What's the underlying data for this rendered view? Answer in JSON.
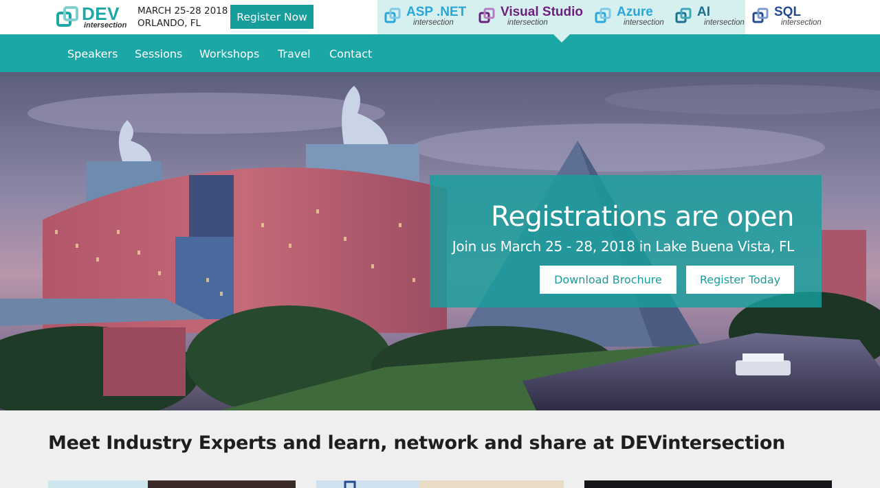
{
  "header": {
    "logo": {
      "title": "DEV",
      "subtitle": "intersection",
      "color": "#1ba7a5"
    },
    "event_date_line1": "MARCH 25-28 2018",
    "event_date_line2": "ORLANDO, FL",
    "register_button": "Register Now",
    "brands": [
      {
        "name": "ASP .NET",
        "sub": "intersection",
        "color": "#2aa6d8",
        "icon": "aspnet-logo-icon"
      },
      {
        "name": "Visual Studio",
        "sub": "intersection",
        "color": "#6b1f7e",
        "icon": "visualstudio-logo-icon"
      },
      {
        "name": "Azure",
        "sub": "intersection",
        "color": "#2aa6d8",
        "icon": "azure-logo-icon"
      },
      {
        "name": "AI",
        "sub": "intersection",
        "color": "#1b6f8f",
        "icon": "ai-logo-icon"
      },
      {
        "name": "SQL",
        "sub": "intersection",
        "color": "#234a8f",
        "icon": "sql-logo-icon"
      }
    ]
  },
  "nav": {
    "items": [
      "Speakers",
      "Sessions",
      "Workshops",
      "Travel",
      "Contact"
    ]
  },
  "hero": {
    "title": "Registrations are open",
    "subtitle": "Join us March 25 - 28, 2018 in Lake Buena Vista, FL",
    "download_button": "Download Brochure",
    "register_button": "Register Today"
  },
  "section": {
    "title": "Meet Industry Experts and learn, network and share at DEVintersection"
  },
  "colors": {
    "teal": "#1ba7a5",
    "teal_dark": "#179e9c",
    "brand_highlight": "#d6f0ef"
  }
}
